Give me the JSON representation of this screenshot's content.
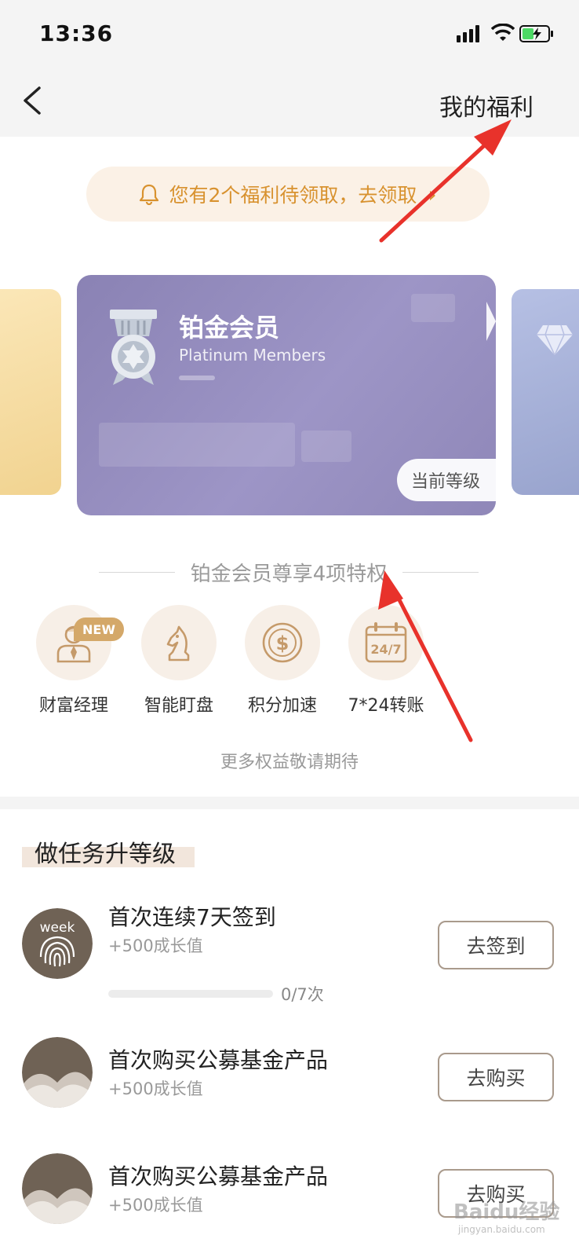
{
  "status_bar": {
    "time": "13:36"
  },
  "nav": {
    "right_title": "我的福利"
  },
  "notice": {
    "text": "您有2个福利待领取，去领取",
    "chevron": "›"
  },
  "card": {
    "title": "铂金会员",
    "subtitle": "Platinum Members",
    "current_level_label": "当前等级"
  },
  "privileges": {
    "heading": "铂金会员尊享4项特权",
    "new_badge": "NEW",
    "items": [
      {
        "label": "财富经理",
        "icon": "manager-icon"
      },
      {
        "label": "智能盯盘",
        "icon": "chess-knight-icon"
      },
      {
        "label": "积分加速",
        "icon": "dollar-coin-icon"
      },
      {
        "label": "7*24转账",
        "icon": "calendar-24-7-icon",
        "icon_text": "24/7"
      }
    ],
    "more_text": "更多权益敬请期待"
  },
  "tasks": {
    "heading": "做任务升等级",
    "items": [
      {
        "title": "首次连续7天签到",
        "reward": "+500成长值",
        "button": "去签到",
        "icon_text": "week",
        "progress_text": "0/7次",
        "progress": 0
      },
      {
        "title": "首次购买公募基金产品",
        "reward": "+500成长值",
        "button": "去购买"
      },
      {
        "title": "首次购买公募基金产品",
        "reward": "+500成长值",
        "button": "去购买"
      }
    ]
  },
  "watermark": {
    "text": "Baidu经验",
    "sub": "jingyan.baidu.com"
  },
  "colors": {
    "accent": "#d8922f",
    "card": "#9d95c6",
    "annotation": "#e8322b"
  }
}
